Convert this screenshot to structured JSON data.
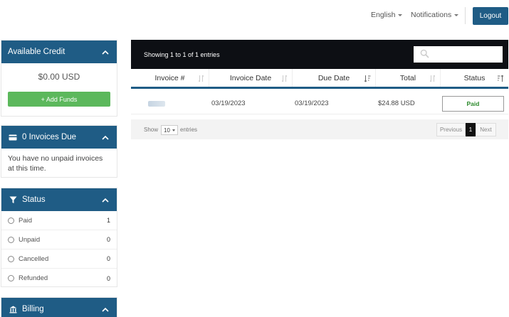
{
  "header": {
    "language_label": "English",
    "notifications_label": "Notifications",
    "logout_label": "Logout"
  },
  "sidebar": {
    "credit": {
      "title": "Available Credit",
      "amount": "$0.00 USD",
      "add_funds_label": "Add Funds"
    },
    "invoices_due": {
      "title": "0 Invoices Due",
      "message": "You have no unpaid invoices at this time."
    },
    "status": {
      "title": "Status",
      "items": [
        {
          "label": "Paid",
          "count": "1"
        },
        {
          "label": "Unpaid",
          "count": "0"
        },
        {
          "label": "Cancelled",
          "count": "0"
        },
        {
          "label": "Refunded",
          "count": "0"
        }
      ]
    },
    "billing": {
      "title": "Billing"
    }
  },
  "table": {
    "showing_text": "Showing 1 to 1 of 1 entries",
    "search_placeholder": "",
    "columns": [
      "Invoice #",
      "Invoice Date",
      "Due Date",
      "Total",
      "Status"
    ],
    "rows": [
      {
        "invoice_number": "",
        "invoice_date": "03/19/2023",
        "due_date": "03/19/2023",
        "total": "$24.88 USD",
        "status": "Paid"
      }
    ],
    "footer": {
      "show_label": "Show",
      "page_length": "10",
      "entries_label": "entries",
      "previous_label": "Previous",
      "current_page": "1",
      "next_label": "Next"
    }
  },
  "colors": {
    "primary": "#1f5c85",
    "success": "#5cb85c",
    "table_header_bg": "#0d0f14",
    "paid_text": "#2c8a2c"
  }
}
